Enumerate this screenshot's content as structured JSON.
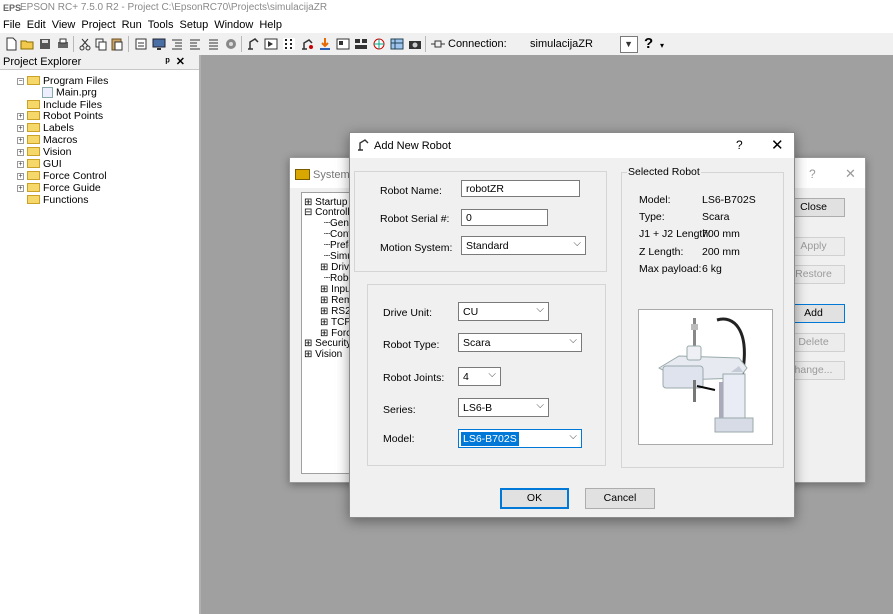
{
  "window": {
    "title": "EPSON RC+ 7.5.0 R2 - Project C:\\EpsonRC70\\Projects\\simulacijaZR"
  },
  "menu": [
    "File",
    "Edit",
    "View",
    "Project",
    "Run",
    "Tools",
    "Setup",
    "Window",
    "Help"
  ],
  "toolbar": {
    "connection_label": "Connection:",
    "connection_value": "simulacijaZR",
    "help_glyph": "?"
  },
  "explorer": {
    "title": "Project Explorer",
    "pin": "¤",
    "close": "✕",
    "items": [
      {
        "label": "Program Files"
      },
      {
        "label": "Main.prg"
      },
      {
        "label": "Include Files"
      },
      {
        "label": "Robot Points"
      },
      {
        "label": "Labels"
      },
      {
        "label": "Macros"
      },
      {
        "label": "Vision"
      },
      {
        "label": "GUI"
      },
      {
        "label": "Force Control"
      },
      {
        "label": "Force Guide"
      },
      {
        "label": "Functions"
      }
    ]
  },
  "system_config": {
    "title": "System C",
    "help": "?",
    "close": "✕",
    "tree": [
      "Startup",
      "Controlle",
      "Gen",
      "Conf",
      "Prefe",
      "Simu",
      "Drive",
      "Robo",
      "Inpu",
      "Rem",
      "RS2",
      "TCP",
      "Forc",
      "Security",
      "Vision"
    ],
    "buttons": {
      "close": "Close",
      "apply": "Apply",
      "restore": "Restore",
      "add": "Add",
      "delete": "Delete",
      "change": "hange..."
    }
  },
  "add_robot": {
    "title": "Add New Robot",
    "help": "?",
    "close": "✕",
    "fields": {
      "robot_name_label": "Robot Name:",
      "robot_name_value": "robotZR",
      "serial_label": "Robot Serial #:",
      "serial_value": "0",
      "motion_label": "Motion System:",
      "motion_value": "Standard",
      "drive_label": "Drive Unit:",
      "drive_value": "CU",
      "type_label": "Robot Type:",
      "type_value": "Scara",
      "joints_label": "Robot Joints:",
      "joints_value": "4",
      "series_label": "Series:",
      "series_value": "LS6-B",
      "model_label": "Model:",
      "model_value": "LS6-B702S"
    },
    "selected": {
      "group_title": "Selected Robot",
      "model_key": "Model:",
      "model_val": "LS6-B702S",
      "type_key": "Type:",
      "type_val": "Scara",
      "len_key": "J1 + J2 Length:",
      "len_val": "700 mm",
      "z_key": "Z Length:",
      "z_val": "200 mm",
      "payload_key": "Max payload:",
      "payload_val": "6 kg"
    },
    "buttons": {
      "ok": "OK",
      "cancel": "Cancel"
    }
  },
  "icons": [
    "new-file-icon",
    "open-icon",
    "save-all-icon",
    "print-icon",
    "cut-icon",
    "copy-icon",
    "paste-icon",
    "robot-manager-icon",
    "connection-icon"
  ]
}
